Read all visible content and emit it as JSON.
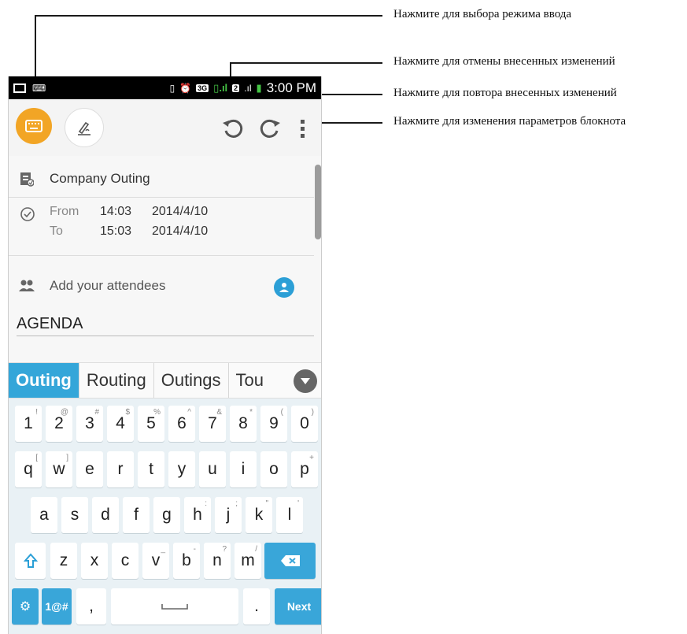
{
  "annotations": {
    "input_mode": "Нажмите для выбора режима ввода",
    "undo": "Нажмите для отмены внесенных изменений",
    "redo": "Нажмите для повтора внесенных изменений",
    "notebook_settings": "Нажмите для изменения параметров блокнота"
  },
  "status_bar": {
    "time": "3:00 PM",
    "network_badge": "3G",
    "sim2_badge": "2"
  },
  "toolbar": {
    "icons": [
      "keyboard-icon",
      "draw-icon",
      "undo-icon",
      "redo-icon",
      "more-vert-icon"
    ],
    "accent": "#f2a525"
  },
  "event": {
    "title": "Company Outing",
    "from_label": "From",
    "from_time": "14:03",
    "from_date": "2014/4/10",
    "to_label": "To",
    "to_time": "15:03",
    "to_date": "2014/4/10",
    "attendees_placeholder": "Add your attendees",
    "agenda": "AGENDA"
  },
  "suggestions": {
    "items": [
      "Outing",
      "Routing",
      "Outings",
      "Tou"
    ],
    "accent": "#34a6d9"
  },
  "keyboard": {
    "rows": [
      [
        {
          "k": "1",
          "h": "!"
        },
        {
          "k": "2",
          "h": "@"
        },
        {
          "k": "3",
          "h": "#"
        },
        {
          "k": "4",
          "h": "$"
        },
        {
          "k": "5",
          "h": "%"
        },
        {
          "k": "6",
          "h": "^"
        },
        {
          "k": "7",
          "h": "&"
        },
        {
          "k": "8",
          "h": "*"
        },
        {
          "k": "9",
          "h": "("
        },
        {
          "k": "0",
          "h": ")"
        }
      ],
      [
        {
          "k": "q",
          "h": "["
        },
        {
          "k": "w",
          "h": "]"
        },
        {
          "k": "e",
          "h": ""
        },
        {
          "k": "r",
          "h": ""
        },
        {
          "k": "t",
          "h": ""
        },
        {
          "k": "y",
          "h": ""
        },
        {
          "k": "u",
          "h": ""
        },
        {
          "k": "i",
          "h": ""
        },
        {
          "k": "o",
          "h": ""
        },
        {
          "k": "p",
          "h": "+"
        }
      ],
      [
        {
          "k": "a",
          "h": ""
        },
        {
          "k": "s",
          "h": ""
        },
        {
          "k": "d",
          "h": ""
        },
        {
          "k": "f",
          "h": ""
        },
        {
          "k": "g",
          "h": ""
        },
        {
          "k": "h",
          "h": ":"
        },
        {
          "k": "j",
          "h": ";"
        },
        {
          "k": "k",
          "h": "\""
        },
        {
          "k": "l",
          "h": "'"
        }
      ],
      [
        {
          "k": "z",
          "h": ""
        },
        {
          "k": "x",
          "h": ""
        },
        {
          "k": "c",
          "h": ""
        },
        {
          "k": "v",
          "h": "_"
        },
        {
          "k": "b",
          "h": "-"
        },
        {
          "k": "n",
          "h": "?"
        },
        {
          "k": "m",
          "h": "/"
        }
      ]
    ],
    "symbols_label": "1@#",
    "comma": ",",
    "period": ".",
    "next_label": "Next",
    "key_accent": "#39a6d9"
  }
}
